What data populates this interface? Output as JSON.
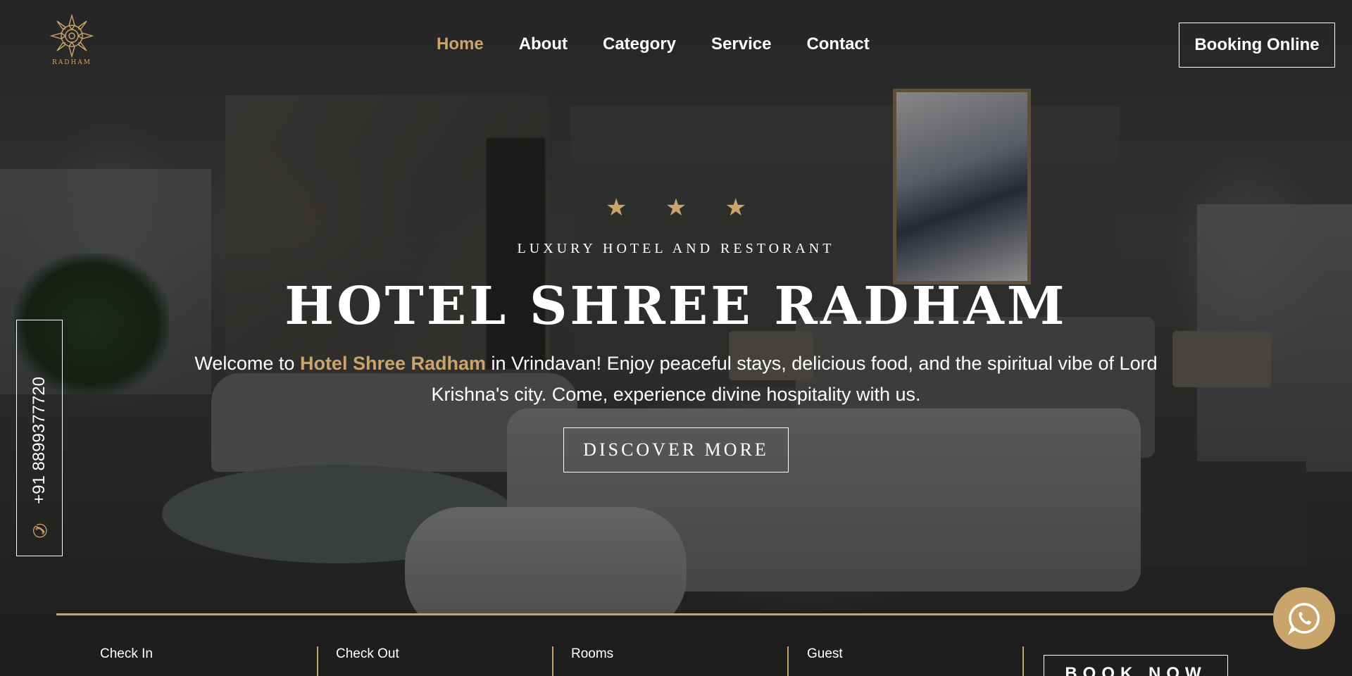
{
  "brand": {
    "logo_text": "RADHAM",
    "gold": "#c9a46b"
  },
  "nav": {
    "items": [
      {
        "label": "Home",
        "active": true
      },
      {
        "label": "About",
        "active": false
      },
      {
        "label": "Category",
        "active": false
      },
      {
        "label": "Service",
        "active": false
      },
      {
        "label": "Contact",
        "active": false
      }
    ],
    "booking_label": "Booking Online"
  },
  "hero": {
    "stars": [
      "★",
      "★",
      "★"
    ],
    "tagline": "LUXURY HOTEL AND RESTORANT",
    "title": "HOTEL SHREE RADHAM",
    "desc_prefix": "Welcome to ",
    "desc_highlight": "Hotel Shree Radham",
    "desc_suffix": " in Vrindavan! Enjoy peaceful stays, delicious food, and the spiritual vibe of Lord Krishna's city. Come, experience divine hospitality with us.",
    "cta_label": "DISCOVER MORE"
  },
  "contact": {
    "phone": "+91 8899377720",
    "phone_icon": "phone-icon",
    "whatsapp_icon": "whatsapp-icon"
  },
  "booking_bar": {
    "fields": [
      {
        "label": "Check In"
      },
      {
        "label": "Check Out"
      },
      {
        "label": "Rooms"
      },
      {
        "label": "Guest"
      }
    ],
    "submit_label": "BOOK NOW"
  }
}
